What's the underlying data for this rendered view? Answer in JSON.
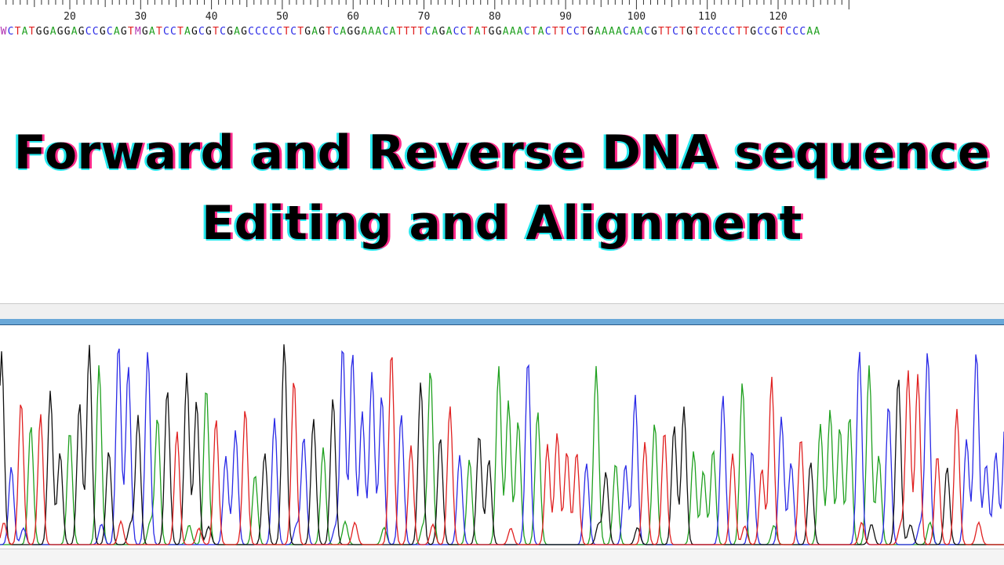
{
  "ruler": {
    "labels": [
      "20",
      "30",
      "40",
      "50",
      "60",
      "70",
      "80",
      "90",
      "100",
      "110",
      "120"
    ]
  },
  "sequence": "WCTATGGAGGAGCCGCAGTMGATCCTAGCGTCGAGCCCCCTCTGAGTCAGGAAACATTTTCAGACCTATGGAAACTACTTCCTGAAAACAACGTTCTGTCCCCCTTGCCGTCCCAA",
  "title": {
    "line1": "Forward and Reverse DNA sequence",
    "line2": "Editing and Alignment"
  },
  "colors": {
    "A": "#1fa01f",
    "C": "#2a2ae6",
    "G": "#111111",
    "T": "#e02020",
    "ambiguous": "#b030b0",
    "title_shadow_left": "#28e8ee",
    "title_shadow_right": "#ff2a8a",
    "header_bar": "#6aa8d8"
  }
}
